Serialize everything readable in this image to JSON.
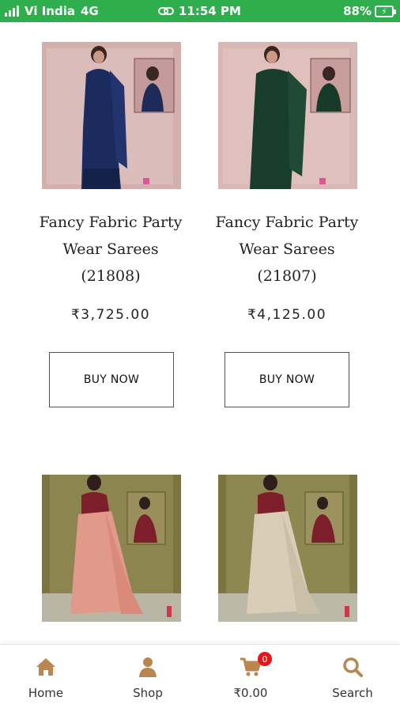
{
  "status_bar": {
    "carrier": "Vi India",
    "network": "4G",
    "time": "11:54 PM",
    "battery": "88%"
  },
  "products": [
    {
      "title_line1": "Fancy Fabric Party",
      "title_line2": "Wear Sarees",
      "title_line3": "(21808)",
      "price": "₹3,725.00",
      "button": "BUY NOW"
    },
    {
      "title_line1": "Fancy Fabric Party",
      "title_line2": "Wear Sarees",
      "title_line3": "(21807)",
      "price": "₹4,125.00",
      "button": "BUY NOW"
    }
  ],
  "bottom_nav": {
    "home": "Home",
    "shop": "Shop",
    "cart_total": "₹0.00",
    "cart_count": "0",
    "search": "Search",
    "icon_color": "#b8864e"
  },
  "colors": {
    "status_bar": "#2fae4e"
  }
}
